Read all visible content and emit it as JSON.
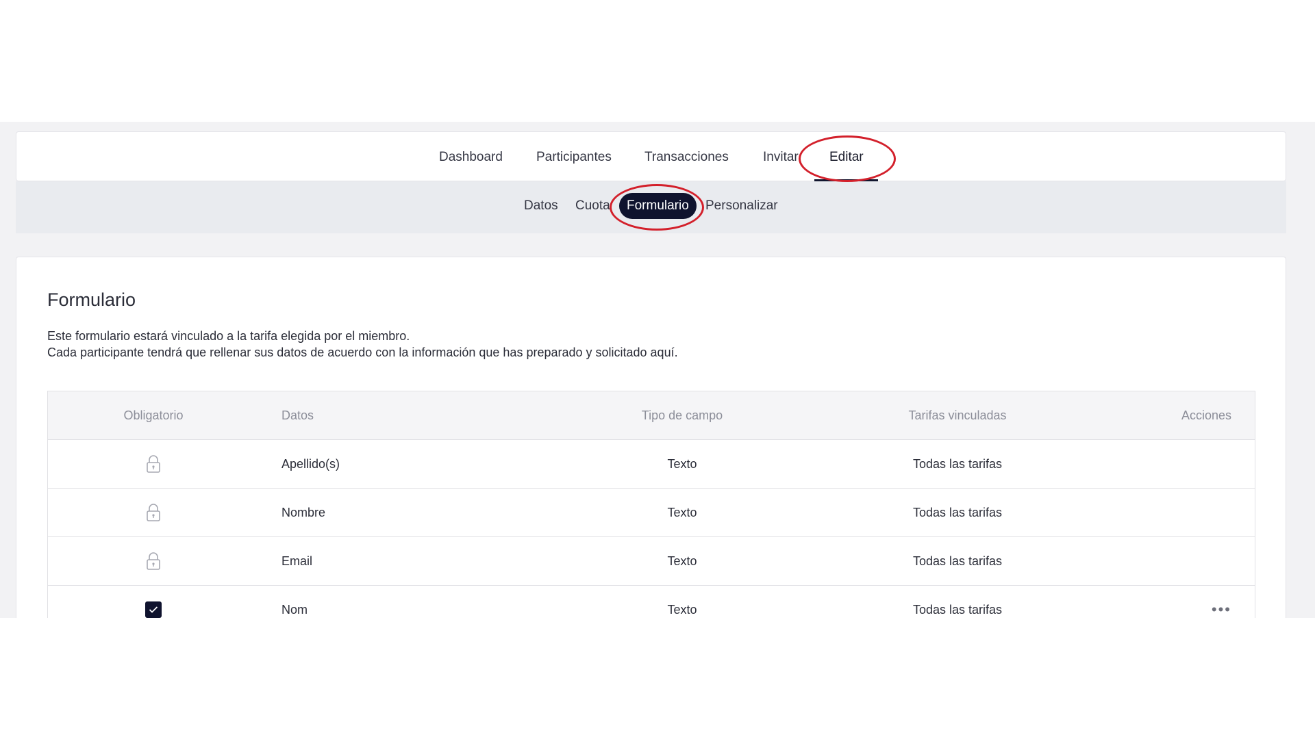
{
  "main_nav": {
    "tabs": [
      {
        "label": "Dashboard"
      },
      {
        "label": "Participantes"
      },
      {
        "label": "Transacciones"
      },
      {
        "label": "Invitar"
      },
      {
        "label": "Editar"
      }
    ],
    "active": "Editar"
  },
  "sub_nav": {
    "tabs": [
      {
        "label": "Datos"
      },
      {
        "label": "Cuota"
      },
      {
        "label": "Formulario"
      },
      {
        "label": "Personalizar"
      }
    ],
    "active": "Formulario"
  },
  "content": {
    "title": "Formulario",
    "description_line1": "Este formulario estará vinculado a la tarifa elegida por el miembro.",
    "description_line2": "Cada participante tendrá que rellenar sus datos de acuerdo con la información que has preparado y solicitado aquí."
  },
  "table": {
    "headers": {
      "obligatorio": "Obligatorio",
      "datos": "Datos",
      "tipo": "Tipo de campo",
      "tarifas": "Tarifas vinculadas",
      "acciones": "Acciones"
    },
    "rows": [
      {
        "obligatorio": "locked",
        "datos": "Apellido(s)",
        "tipo": "Texto",
        "tarifas": "Todas las tarifas"
      },
      {
        "obligatorio": "locked",
        "datos": "Nombre",
        "tipo": "Texto",
        "tarifas": "Todas las tarifas"
      },
      {
        "obligatorio": "locked",
        "datos": "Email",
        "tipo": "Texto",
        "tarifas": "Todas las tarifas"
      },
      {
        "obligatorio": "checked",
        "datos": "Nom",
        "tipo": "Texto",
        "tarifas": "Todas las tarifas",
        "actions": "more"
      }
    ]
  },
  "colors": {
    "accent_dark": "#0f132e",
    "annotation_red": "#d3202b"
  },
  "icons": {
    "lock": "lock-icon",
    "checkbox": "checkbox-checked-icon",
    "more": "more-horizontal-icon"
  }
}
